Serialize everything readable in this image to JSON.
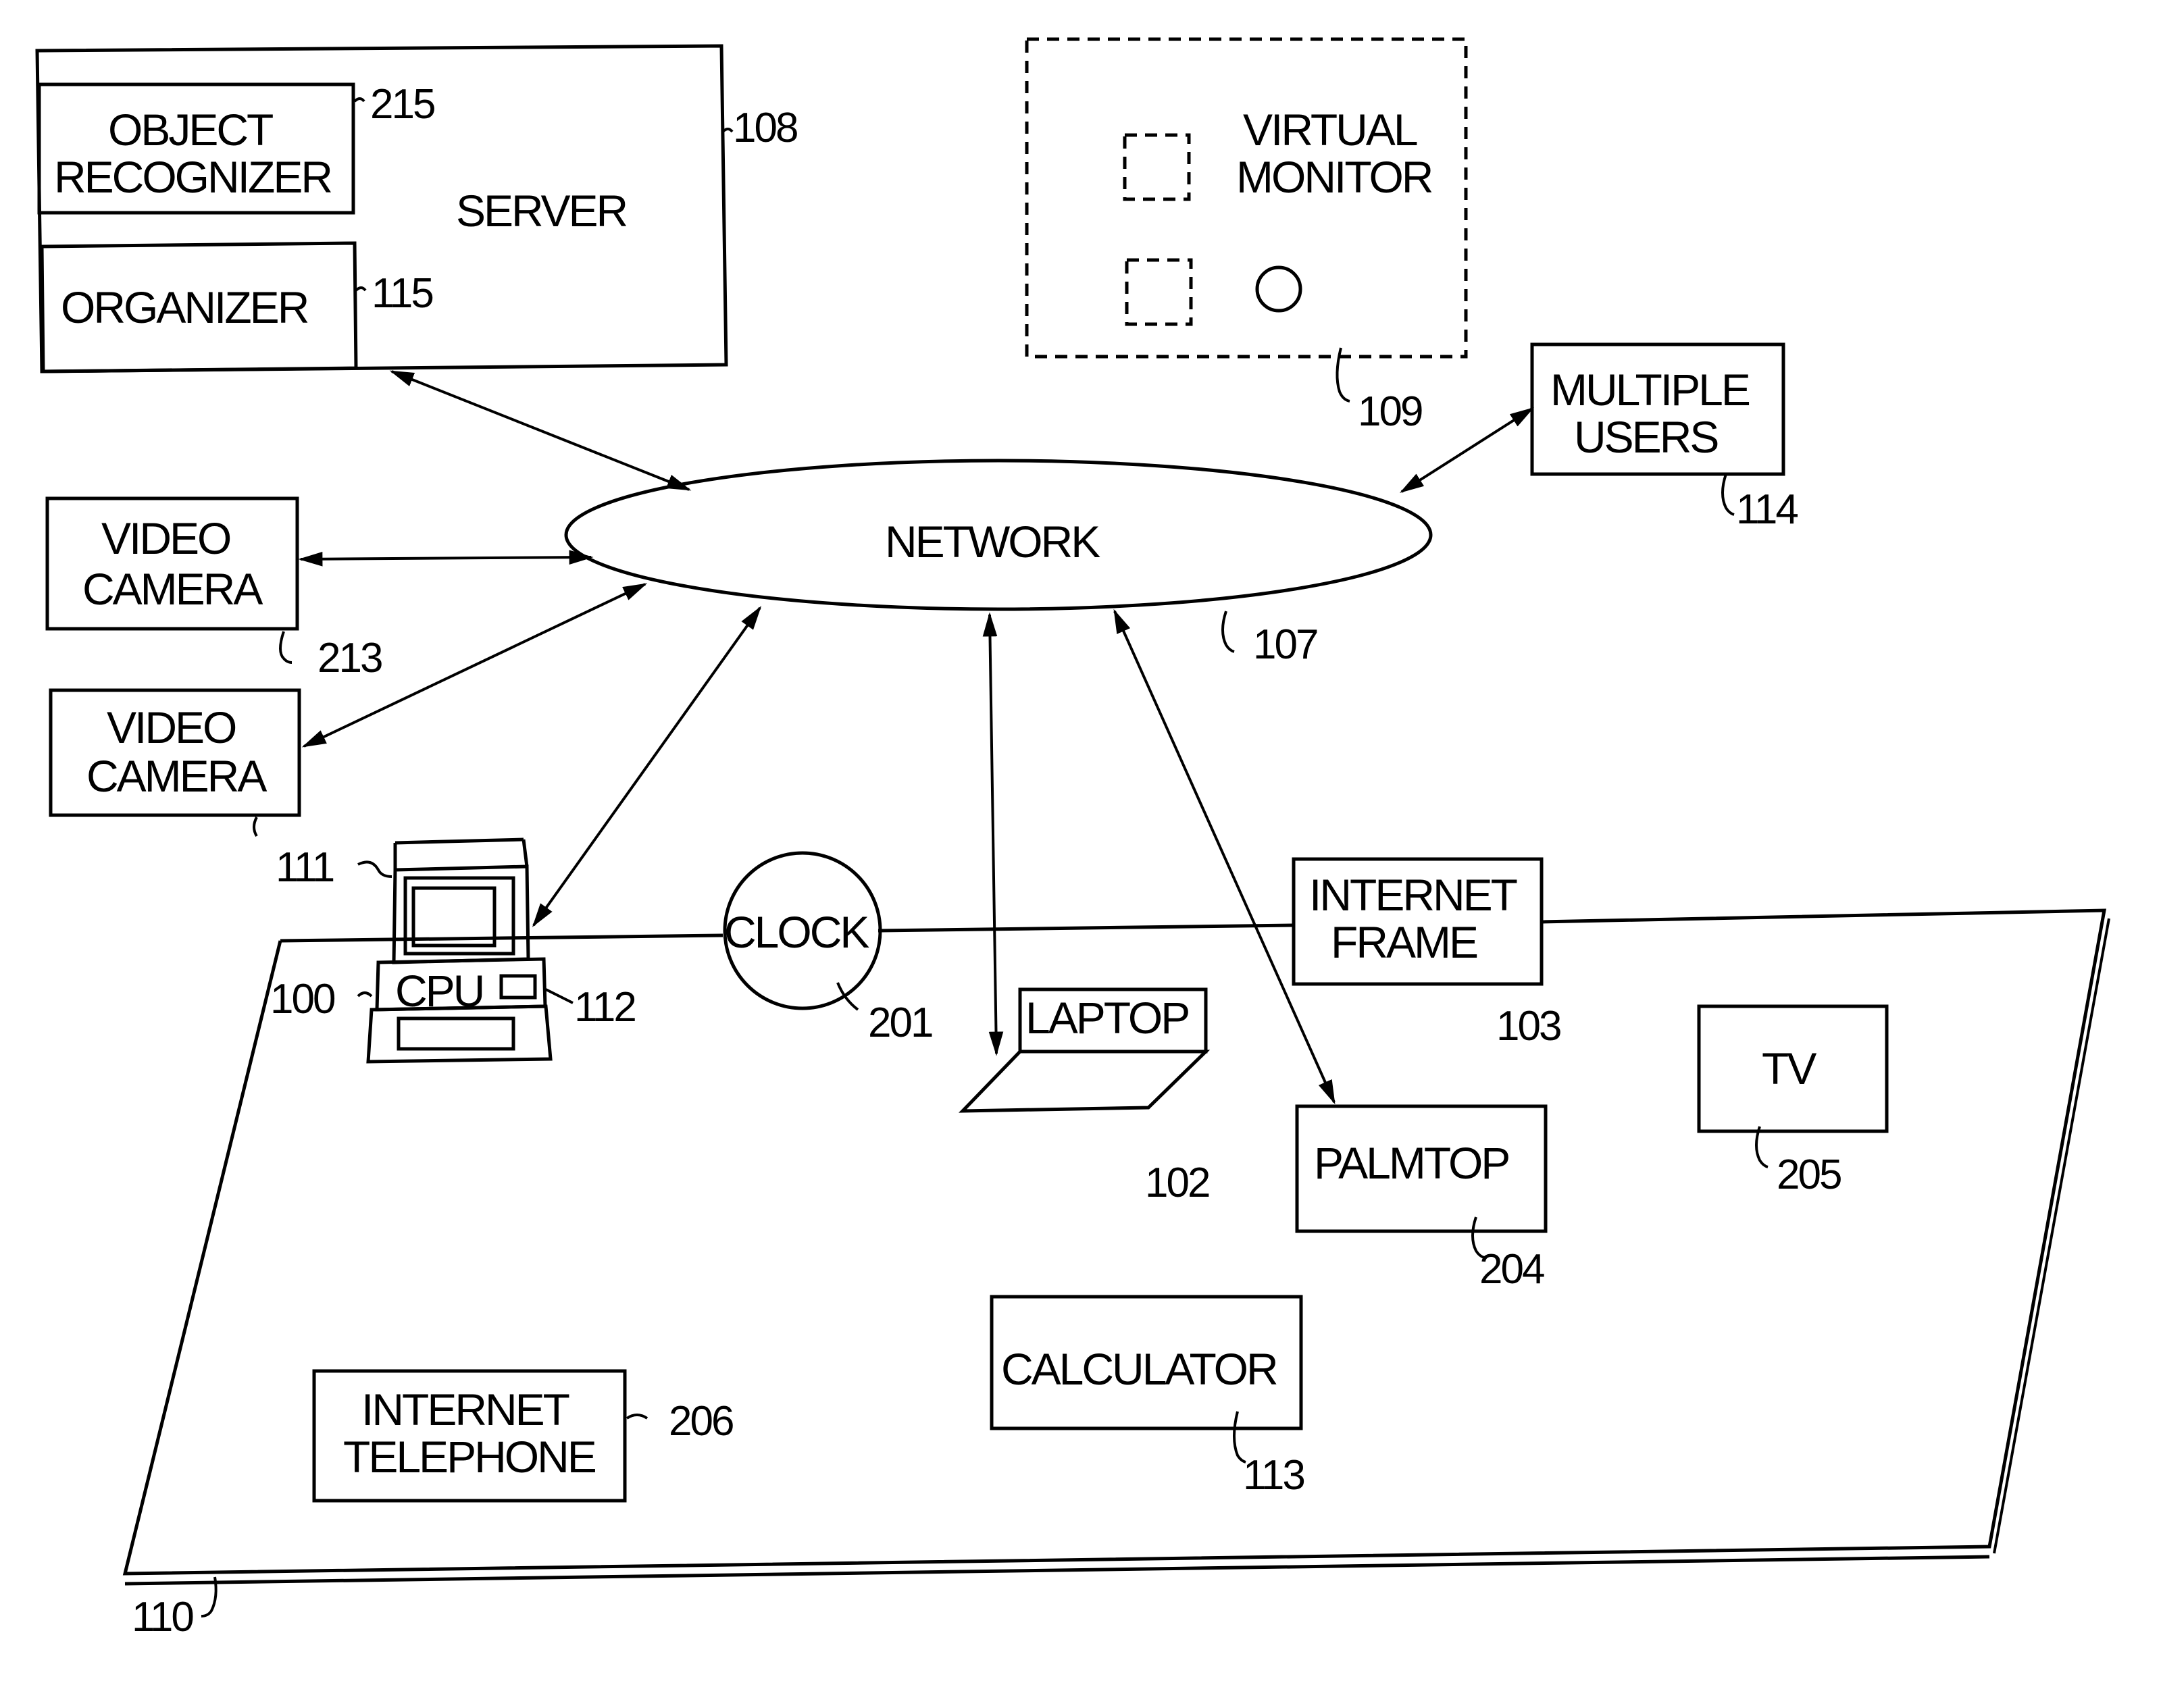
{
  "figure": {
    "server": {
      "label": "SERVER",
      "ref": "108"
    },
    "object_recognizer": {
      "line1": "OBJECT",
      "line2": "RECOGNIZER",
      "ref": "215"
    },
    "organizer": {
      "label": "ORGANIZER",
      "ref": "115"
    },
    "virtual_monitor": {
      "line1": "VIRTUAL",
      "line2": "MONITOR",
      "ref": "109"
    },
    "multiple_users": {
      "line1": "MULTIPLE",
      "line2": "USERS",
      "ref": "114"
    },
    "network": {
      "label": "NETWORK",
      "ref": "107"
    },
    "video_camera_1": {
      "line1": "VIDEO",
      "line2": "CAMERA",
      "ref": "213"
    },
    "video_camera_2": {
      "line1": "VIDEO",
      "line2": "CAMERA"
    },
    "computer": {
      "cpu_label": "CPU",
      "monitor_ref": "111",
      "cpu_ref": "100",
      "drive_ref": "112"
    },
    "clock": {
      "label": "CLOCK",
      "ref": "201"
    },
    "laptop": {
      "label": "LAPTOP"
    },
    "internet_frame": {
      "line1": "INTERNET",
      "line2": "FRAME",
      "ref": "103"
    },
    "tv": {
      "label": "TV",
      "ref": "205"
    },
    "palmtop": {
      "label": "PALMTOP",
      "ref": "204"
    },
    "calculator": {
      "label": "CALCULATOR",
      "ref": "113"
    },
    "internet_telephone": {
      "line1": "INTERNET",
      "line2": "TELEPHONE",
      "ref": "206"
    },
    "room": {
      "ref_floor": "102",
      "ref_base": "110"
    }
  }
}
